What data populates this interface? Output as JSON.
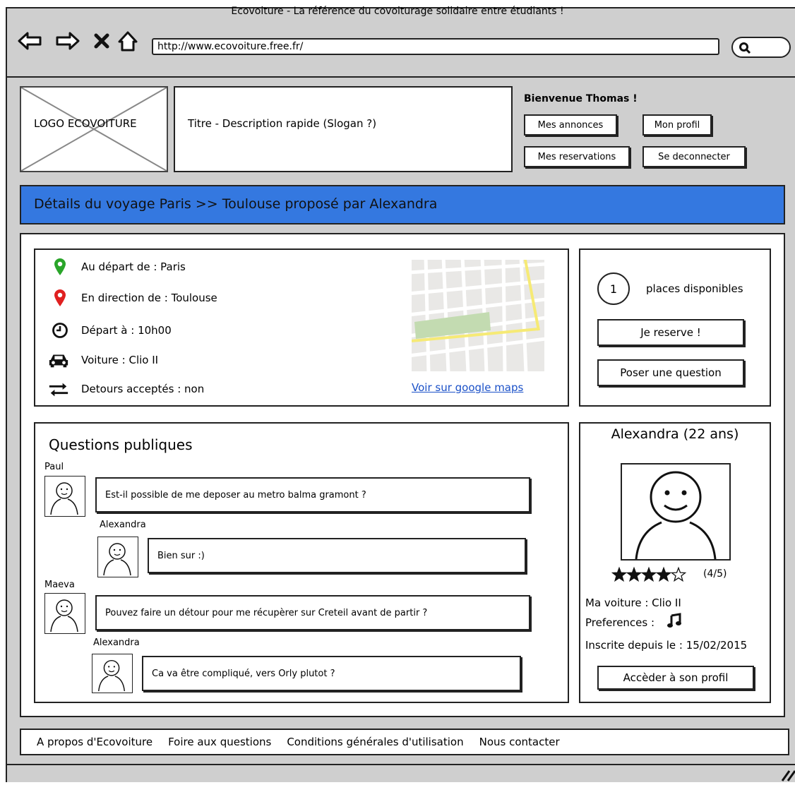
{
  "browser": {
    "window_title": "Ecovoiture - La référence du covoiturage solidaire entre étudiants !",
    "url": "http://www.ecovoiture.free.fr/"
  },
  "header": {
    "logo_text": "LOGO ECOVOITURE",
    "title_text": "Titre - Description rapide (Slogan ?)",
    "welcome": "Bienvenue Thomas !",
    "buttons": {
      "my_ads": "Mes annonces",
      "my_profile": "Mon profil",
      "my_reservations": "Mes reservations",
      "logout": "Se deconnecter"
    }
  },
  "banner": {
    "title": "Détails du voyage Paris >> Toulouse proposé par Alexandra"
  },
  "trip": {
    "departure": "Au départ de : Paris",
    "destination": "En direction de : Toulouse",
    "time": "Départ à : 10h00",
    "car": "Voiture : Clio II",
    "detours": "Detours acceptés : non",
    "map_link": "Voir sur google maps"
  },
  "booking": {
    "places_count": "1",
    "places_label": "places disponibles",
    "reserve_label": "Je reserve !",
    "ask_label": "Poser une question"
  },
  "questions": {
    "heading": "Questions publiques",
    "threads": [
      {
        "author": "Paul",
        "text": "Est-il possible de me deposer au metro balma gramont ?",
        "reply_author": "Alexandra",
        "reply_text": "Bien sur :)"
      },
      {
        "author": "Maeva",
        "text": "Pouvez faire un détour pour me récupèrer sur Creteil avant de partir ?",
        "reply_author": "Alexandra",
        "reply_text": "Ca va être compliqué, vers Orly plutot ?"
      }
    ]
  },
  "driver": {
    "name": "Alexandra (22 ans)",
    "rating_text": "(4/5)",
    "rating_value": 4,
    "rating_max": 5,
    "car": "Ma voiture : Clio II",
    "preferences": "Preferences :",
    "preferences_icon": "music-note-icon",
    "since": "Inscrite depuis le : 15/02/2015",
    "profile_button": "Accèder à son profil"
  },
  "footer": {
    "links": [
      "A propos d'Ecovoiture",
      "Foire aux questions",
      "Conditions générales d'utilisation",
      "Nous contacter"
    ]
  },
  "colors": {
    "banner": "#3478e0",
    "pin_green": "#2aa52a",
    "pin_red": "#e02020",
    "link": "#1a50c8",
    "browser_chrome": "#cfcfcf"
  }
}
